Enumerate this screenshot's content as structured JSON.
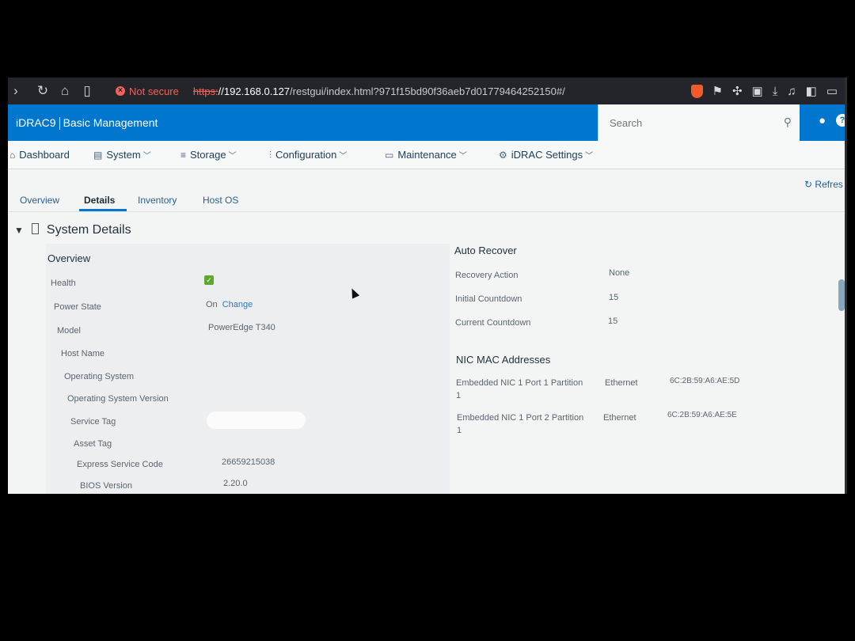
{
  "browser": {
    "security_label": "Not secure",
    "url_scheme": "https:",
    "url_host": "//192.168.0.127",
    "url_path": "/restgui/index.html?971f15bd90f36aeb7d01779464252150#/"
  },
  "header": {
    "brand_product": "iDRAC9",
    "brand_edition": "Basic Management",
    "search_placeholder": "Search"
  },
  "nav": {
    "items": [
      {
        "label": "Dashboard",
        "icon": "home-icon"
      },
      {
        "label": "System",
        "icon": "server-icon"
      },
      {
        "label": "Storage",
        "icon": "database-icon"
      },
      {
        "label": "Configuration",
        "icon": "sliders-icon"
      },
      {
        "label": "Maintenance",
        "icon": "monitor-icon"
      },
      {
        "label": "iDRAC Settings",
        "icon": "gears-icon"
      }
    ]
  },
  "refresh_label": "Refres",
  "tabs": [
    "Overview",
    "Details",
    "Inventory",
    "Host OS"
  ],
  "section_title": "System Details",
  "overview": {
    "heading": "Overview",
    "rows": [
      {
        "label": "Health",
        "value": ""
      },
      {
        "label": "Power State",
        "value": "On",
        "link": "Change"
      },
      {
        "label": "Model",
        "value": "PowerEdge T340"
      },
      {
        "label": "Host Name",
        "value": ""
      },
      {
        "label": "Operating System",
        "value": ""
      },
      {
        "label": "Operating System Version",
        "value": ""
      },
      {
        "label": "Service Tag",
        "value": ""
      },
      {
        "label": "Asset Tag",
        "value": ""
      },
      {
        "label": "Express Service Code",
        "value": "26659215038"
      },
      {
        "label": "BIOS Version",
        "value": "2.20.0"
      }
    ]
  },
  "auto_recover": {
    "heading": "Auto Recover",
    "rows": [
      {
        "label": "Recovery Action",
        "value": "None"
      },
      {
        "label": "Initial Countdown",
        "value": "15"
      },
      {
        "label": "Current Countdown",
        "value": "15"
      }
    ]
  },
  "nic": {
    "heading": "NIC MAC Addresses",
    "rows": [
      {
        "label": "Embedded NIC 1 Port 1 Partition",
        "label2": "1",
        "type": "Ethernet",
        "mac": "6C:2B:59:A6:AE:5D"
      },
      {
        "label": "Embedded NIC 1 Port 2 Partition",
        "label2": "1",
        "type": "Ethernet",
        "mac": "6C:2B:59:A6:AE:5E"
      }
    ]
  }
}
